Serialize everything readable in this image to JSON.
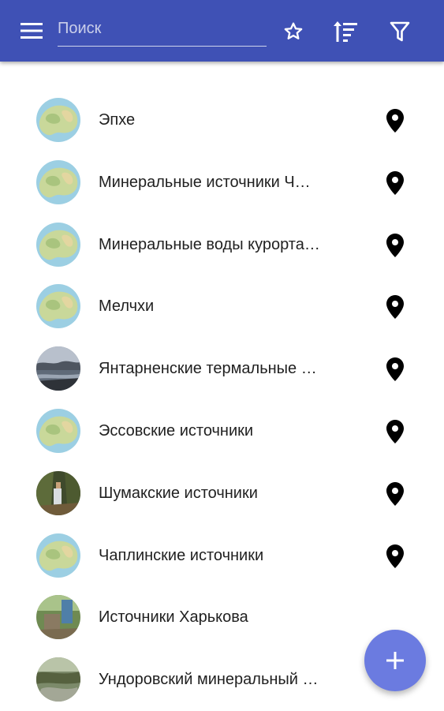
{
  "app_bar": {
    "background_color": "#3f51b5",
    "menu_icon": "menu-icon",
    "search": {
      "placeholder": "Поиск",
      "value": ""
    },
    "actions": [
      "star-outline-icon",
      "sort-icon",
      "filter-icon"
    ]
  },
  "items": [
    {
      "label": "Эпхе",
      "avatar": "map-thumbnail",
      "has_location": true
    },
    {
      "label": "Минеральные источники Ч…",
      "avatar": "map-thumbnail",
      "has_location": true
    },
    {
      "label": "Минеральные воды курорта…",
      "avatar": "map-thumbnail",
      "has_location": true
    },
    {
      "label": "Мелчхи",
      "avatar": "map-thumbnail",
      "has_location": true
    },
    {
      "label": "Янтарненские термальные …",
      "avatar": "lake-photo",
      "has_location": true
    },
    {
      "label": "Эссовские источники",
      "avatar": "map-thumbnail",
      "has_location": true
    },
    {
      "label": "Шумакские источники",
      "avatar": "forest-photo",
      "has_location": true
    },
    {
      "label": "Чаплинские источники",
      "avatar": "map-thumbnail",
      "has_location": true
    },
    {
      "label": "Источники Харькова",
      "avatar": "park-photo",
      "has_location": false
    },
    {
      "label": "Ундоровский минеральный …",
      "avatar": "stream-photo",
      "has_location": false
    }
  ],
  "fab": {
    "icon": "plus-icon",
    "color": "#6b7be0"
  }
}
